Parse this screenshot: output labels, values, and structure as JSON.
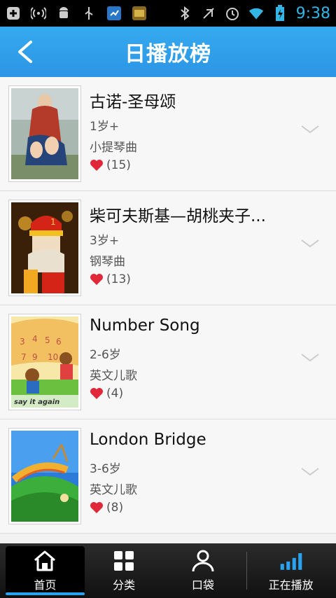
{
  "status_bar": {
    "time": "9:38",
    "icons_left": [
      "plus-icon",
      "wireless-icon",
      "android-icon",
      "usb-icon",
      "sync-icon",
      "story-app-icon"
    ],
    "icons_right": [
      "bluetooth-icon",
      "mute-icon",
      "alarm-icon",
      "wifi-icon",
      "battery-icon"
    ]
  },
  "header": {
    "title": "日播放榜"
  },
  "items": [
    {
      "title": "古诺-圣母颂",
      "age": "1岁+",
      "genre": "小提琴曲",
      "likes": "(15)"
    },
    {
      "title": "柴可夫斯基—胡桃夹子...",
      "age": "3岁+",
      "genre": "钢琴曲",
      "likes": "(13)"
    },
    {
      "title": "Number Song",
      "age": "2-6岁",
      "genre": "英文儿歌",
      "likes": "(4)"
    },
    {
      "title": "London Bridge",
      "age": "3-6岁",
      "genre": "英文儿歌",
      "likes": "(8)"
    }
  ],
  "thumb3_text": "say it again",
  "bottom_nav": {
    "home": "首页",
    "category": "分类",
    "pocket": "口袋",
    "now_playing": "正在播放"
  },
  "colors": {
    "accent": "#2c9ee8",
    "heart": "#e0283a"
  }
}
